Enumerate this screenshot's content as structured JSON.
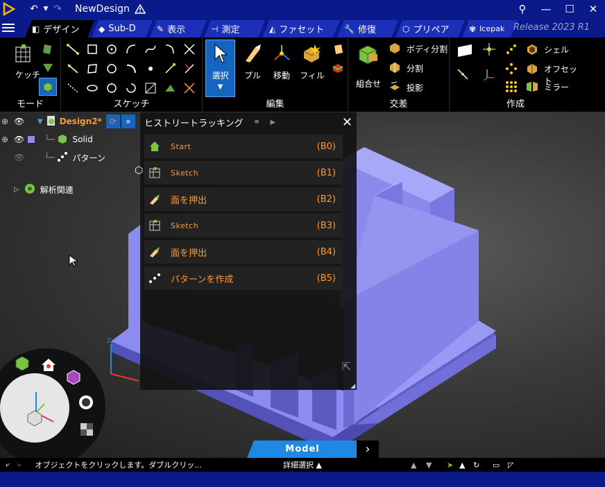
{
  "titlebar": {
    "title": "NewDesign"
  },
  "tabs": [
    {
      "label": "デザイン",
      "active": true
    },
    {
      "label": "Sub-D"
    },
    {
      "label": "表示"
    },
    {
      "label": "測定"
    },
    {
      "label": "ファセット"
    },
    {
      "label": "修復"
    },
    {
      "label": "プリペア"
    },
    {
      "label": "Icepak"
    }
  ],
  "release_label": "Release 2023 R1",
  "ribbon": {
    "mode": {
      "label": "モード",
      "sketch_label": "ケッチ"
    },
    "sketch": {
      "label": "スケッチ"
    },
    "edit": {
      "label": "編集",
      "select": "選択",
      "pull": "プル",
      "move": "移動",
      "fill": "フィル"
    },
    "intersect": {
      "label": "交差",
      "combine": "組合せ",
      "split_body": "ボディ分割",
      "split": "分割",
      "project": "投影"
    },
    "create": {
      "label": "作成",
      "shell": "シェル",
      "offset": "オフセット",
      "mirror": "ミラー"
    }
  },
  "tree": {
    "design_name": "Design2*",
    "solid": "Solid",
    "pattern": "パターン",
    "analysis": "解析関連"
  },
  "history": {
    "title": "ヒストリートラッキング",
    "items": [
      {
        "label": "Start",
        "tag": "(B0)",
        "icon": "home-icon"
      },
      {
        "label": "Sketch",
        "tag": "(B1)",
        "icon": "sketch-icon"
      },
      {
        "label": "面を押出",
        "tag": "(B2)",
        "icon": "extrude-icon"
      },
      {
        "label": "Sketch",
        "tag": "(B3)",
        "icon": "sketch-icon"
      },
      {
        "label": "面を押出",
        "tag": "(B4)",
        "icon": "extrude-icon"
      },
      {
        "label": "パターンを作成",
        "tag": "(B5)",
        "icon": "pattern-icon"
      }
    ]
  },
  "model_tab": {
    "label": "Model"
  },
  "status": {
    "message": "オブジェクトをクリックします。ダブルクリッ...",
    "detail_select": "詳細選択"
  },
  "colors": {
    "title_blue": "#0a1a8a",
    "accent_orange": "#ff9933",
    "model_purple": "#8c8cf0",
    "select_blue": "#1565c0"
  }
}
